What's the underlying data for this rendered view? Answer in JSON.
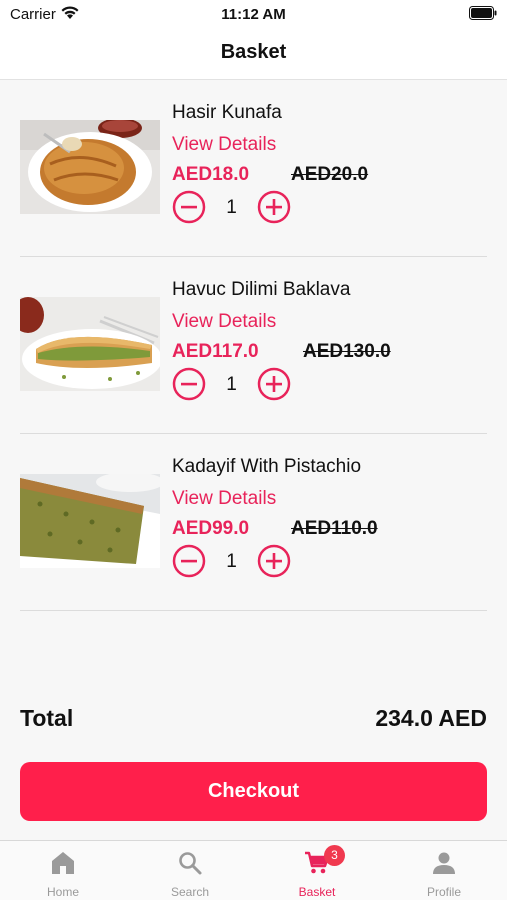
{
  "status_bar": {
    "carrier": "Carrier",
    "time": "11:12 AM"
  },
  "nav": {
    "title": "Basket"
  },
  "colors": {
    "accent": "#e8235a",
    "checkout": "#ff1f4b",
    "badge": "#f0394f"
  },
  "items": [
    {
      "name": "Hasir Kunafa",
      "details_label": "View Details",
      "price": "AED18.0",
      "old_price": "AED20.0",
      "quantity": "1",
      "image": "kunafa-photo"
    },
    {
      "name": "Havuc Dilimi Baklava",
      "details_label": "View Details",
      "price": "AED117.0",
      "old_price": "AED130.0",
      "quantity": "1",
      "image": "baklava-photo"
    },
    {
      "name": "Kadayif With Pistachio",
      "details_label": "View Details",
      "price": "AED99.0",
      "old_price": "AED110.0",
      "quantity": "1",
      "image": "kadayif-photo"
    }
  ],
  "summary": {
    "total_label": "Total",
    "total_value": "234.0 AED"
  },
  "checkout_label": "Checkout",
  "tabs": [
    {
      "label": "Home",
      "icon": "home-icon"
    },
    {
      "label": "Search",
      "icon": "search-icon"
    },
    {
      "label": "Basket",
      "icon": "cart-icon",
      "badge": "3",
      "active": true
    },
    {
      "label": "Profile",
      "icon": "person-icon"
    }
  ]
}
